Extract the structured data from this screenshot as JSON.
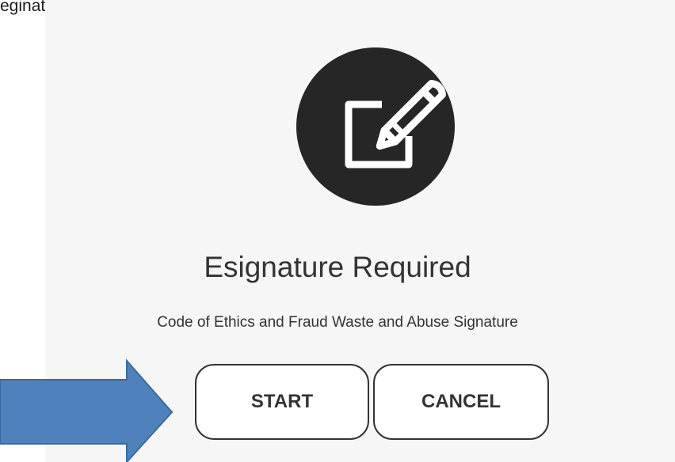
{
  "background_doc": {
    "text": "eginates the esignature prompt page"
  },
  "dialog": {
    "icon": "edit-pencil-icon",
    "title": "Esignature Required",
    "subtitle": "Code of Ethics and Fraud Waste and Abuse Signature",
    "buttons": {
      "start": "START",
      "cancel": "CANCEL"
    }
  },
  "annotation": {
    "arrow_icon": "blue-arrow-right",
    "color": "#4f81bd"
  }
}
